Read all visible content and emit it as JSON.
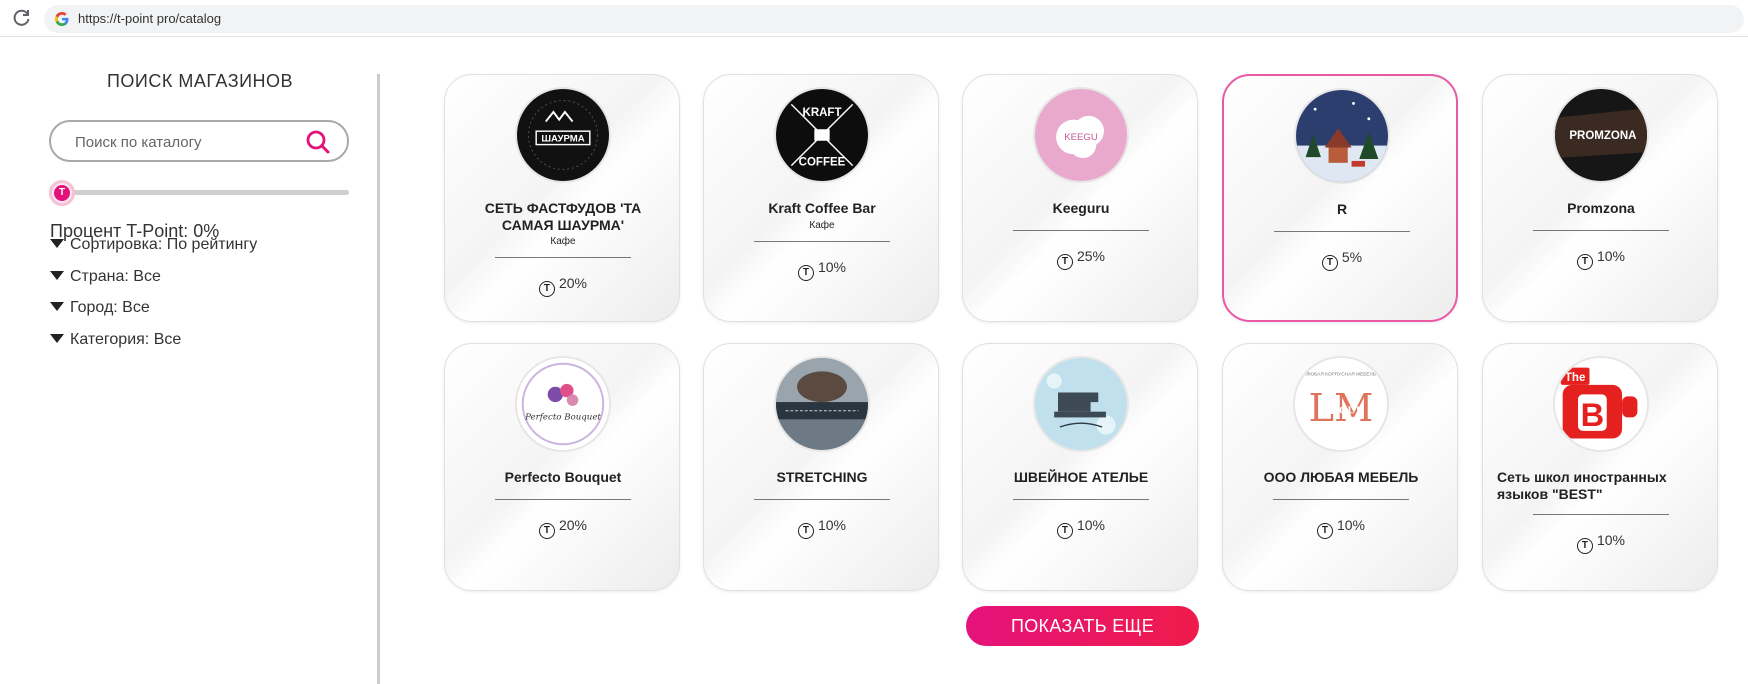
{
  "browser": {
    "url": "https://t-point pro/catalog"
  },
  "sidebar": {
    "title": "ПОИСК МАГАЗИНОВ",
    "search_placeholder": "Поиск по каталогу",
    "percent_label": "Процент T-Point: 0%",
    "percent_value": 0,
    "filters": [
      "Сортировка: По рейтингу",
      "Страна: Все",
      "Город: Все",
      "Категория: Все"
    ]
  },
  "cards": [
    {
      "name": "СЕТЬ ФАСТФУДОВ 'ТА САМАЯ ШАУРМА'",
      "category": "Кафе",
      "percent": "20%",
      "logo": "shaurma-logo"
    },
    {
      "name": "Kraft Coffee Bar",
      "category": "Кафе",
      "percent": "10%",
      "logo": "kraft-coffee-logo"
    },
    {
      "name": "Keeguru",
      "category": "",
      "percent": "25%",
      "logo": "keeguru-logo"
    },
    {
      "name": "R",
      "category": "",
      "percent": "5%",
      "logo": "winter-scene-logo"
    },
    {
      "name": "Promzona",
      "category": "",
      "percent": "10%",
      "logo": "promzona-logo"
    },
    {
      "name": "Perfecto Bouquet",
      "category": "",
      "percent": "20%",
      "logo": "perfecto-bouquet-logo"
    },
    {
      "name": "STRETCHING",
      "category": "",
      "percent": "10%",
      "logo": "stretching-logo"
    },
    {
      "name": "ШВЕЙНОЕ АТЕЛЬЕ",
      "category": "",
      "percent": "10%",
      "logo": "sewing-machine-logo"
    },
    {
      "name": "ООО ЛЮБАЯ МЕБЕЛЬ",
      "category": "",
      "percent": "10%",
      "logo": "lm-group-logo"
    },
    {
      "name": "Сеть школ иностранных языков \"BEST\"",
      "category": "",
      "percent": "10%",
      "logo": "the-best-logo"
    }
  ],
  "logo_text": {
    "shaurma": "ШАУРМА",
    "kraft_top": "KRAFT",
    "kraft_bottom": "COFFEE",
    "keeguru": "KEEGU",
    "promzona": "PROMZONA",
    "perfecto": "Perfecto Bouquet",
    "lm": "LM",
    "lm_group": "GROUP",
    "lm_top": "ЛЮБАЯ КОРПУСНАЯ МЕБЕЛЬ",
    "best_the": "The",
    "best_b": "B"
  },
  "more_button": "ПОКАЗАТЬ ЕЩЕ",
  "colors": {
    "accent": "#e5127d",
    "active_border": "#e85aa6"
  }
}
